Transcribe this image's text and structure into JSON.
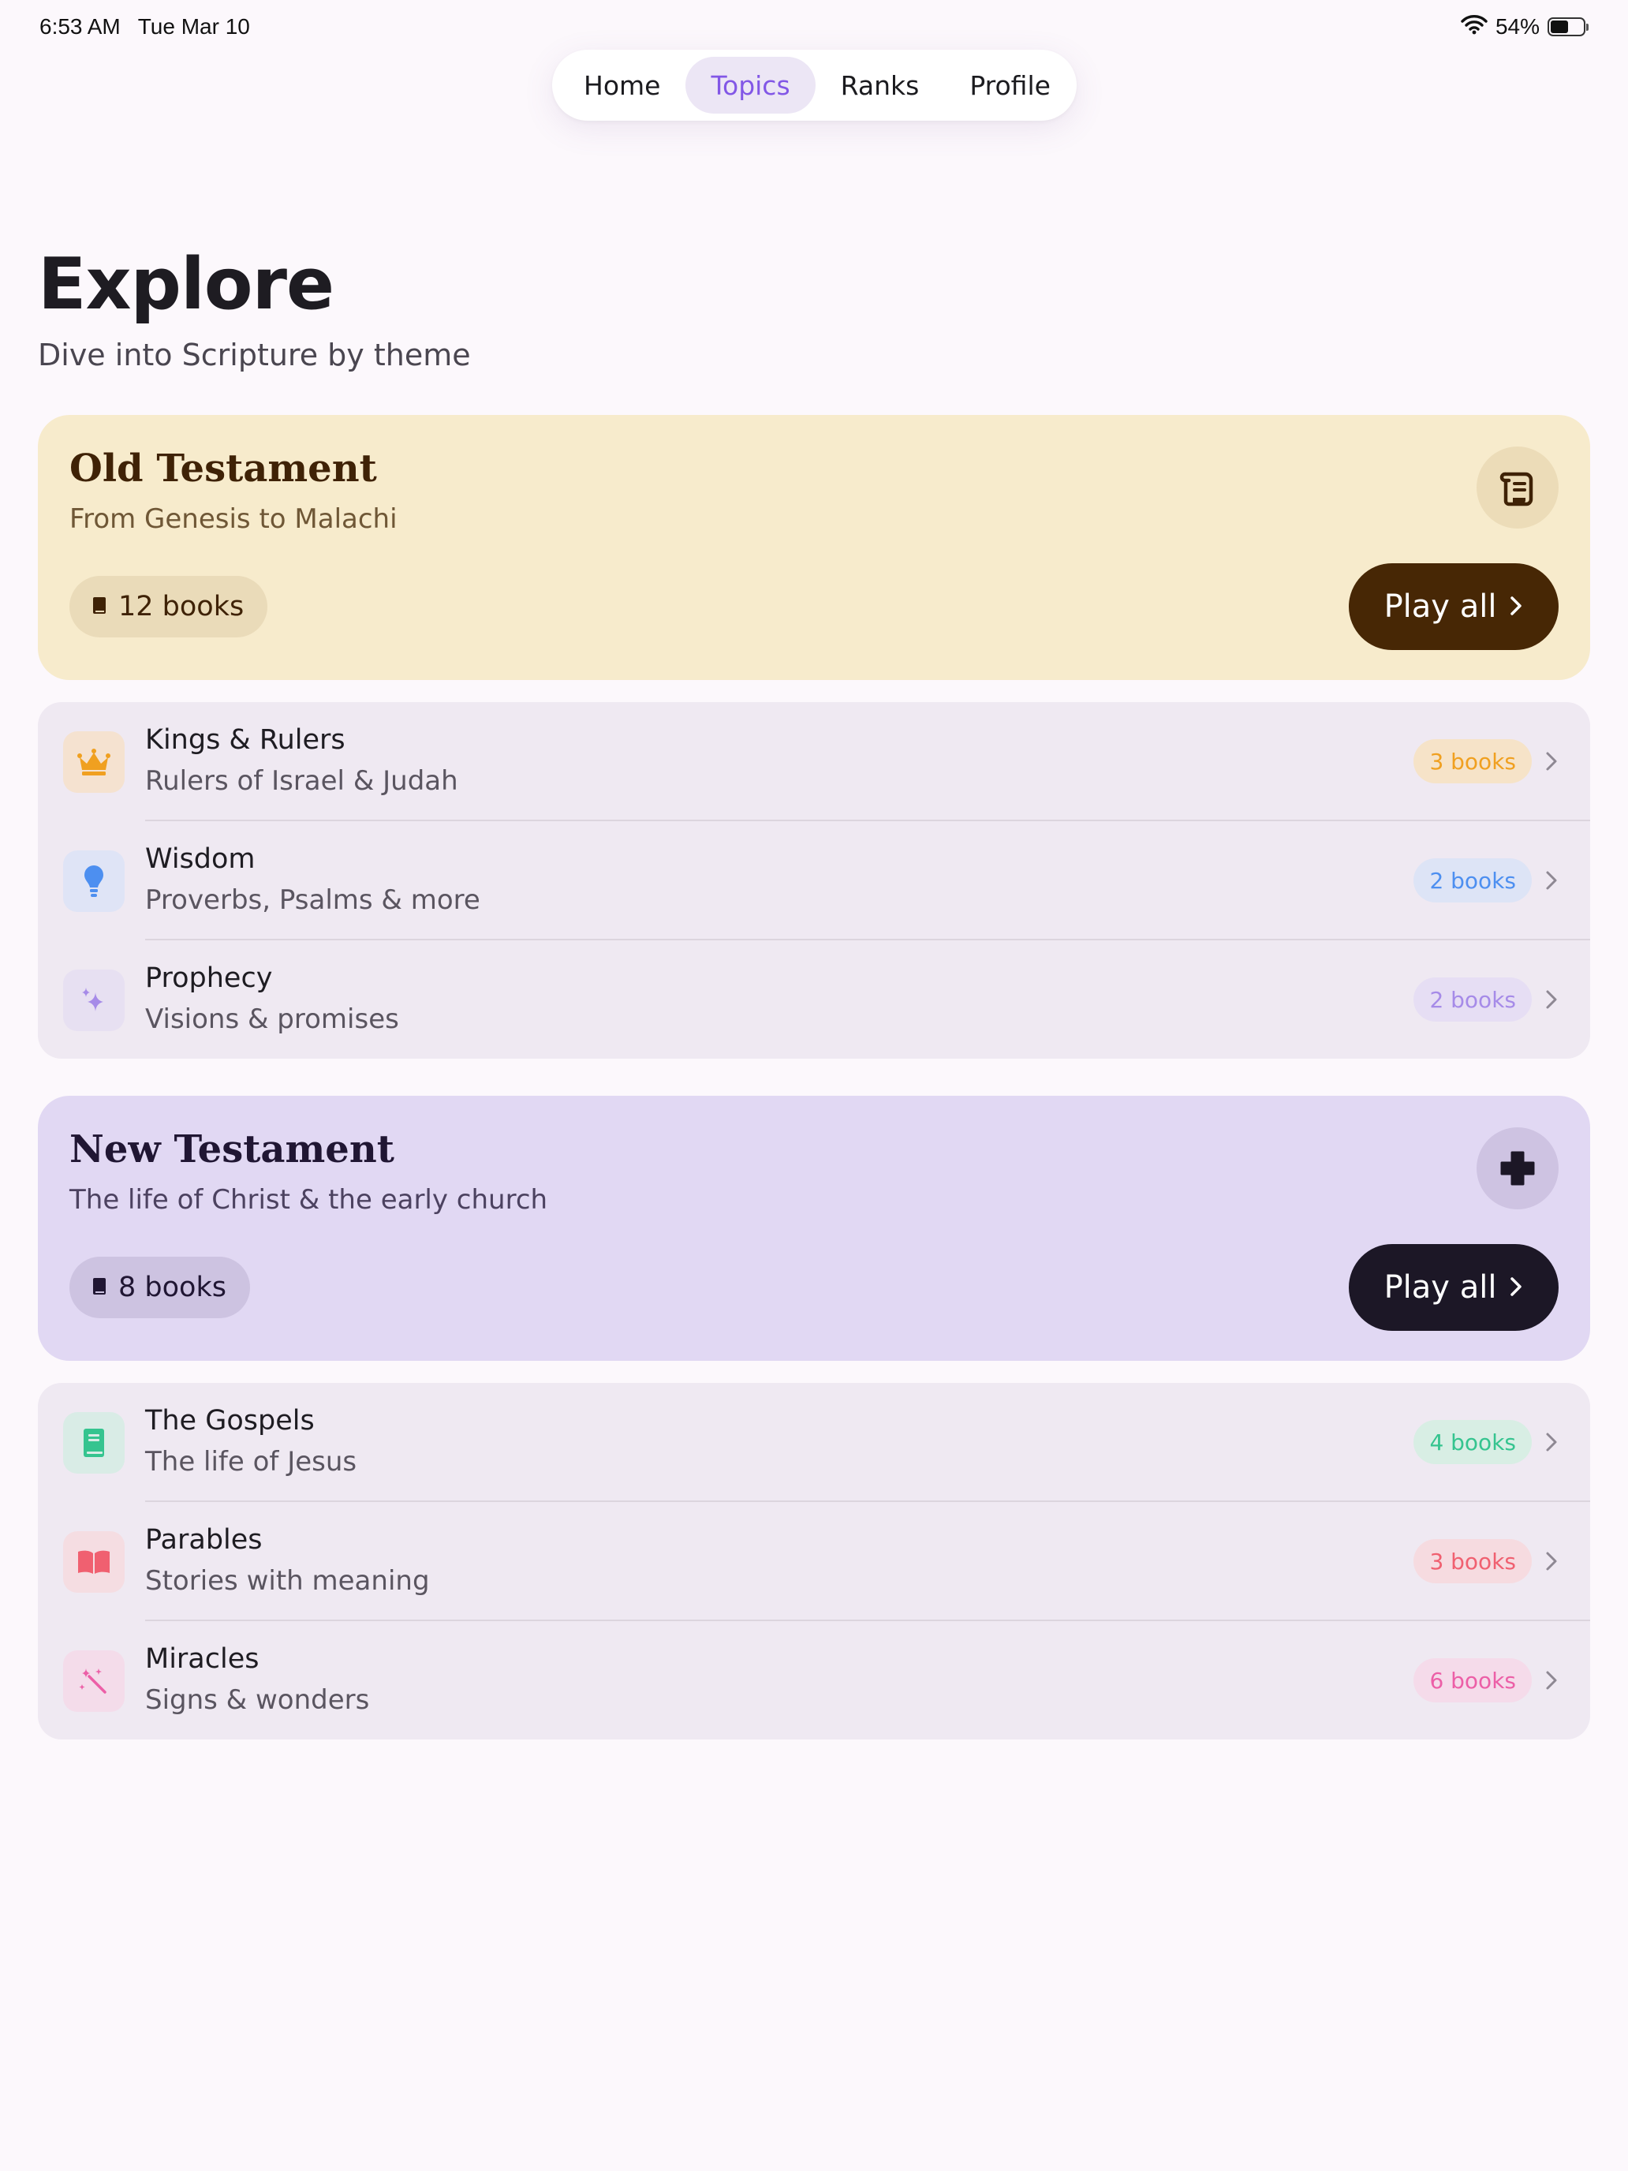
{
  "status_bar": {
    "time": "6:53 AM",
    "date": "Tue Mar 10",
    "battery_percent_label": "54%",
    "battery_level": 0.54,
    "icons": [
      "wifi-icon",
      "battery-icon"
    ]
  },
  "nav": {
    "tabs": [
      {
        "label": "Home",
        "active": false
      },
      {
        "label": "Topics",
        "active": true
      },
      {
        "label": "Ranks",
        "active": false
      },
      {
        "label": "Profile",
        "active": false
      }
    ],
    "active_color": "#8257e6"
  },
  "page": {
    "title": "Explore",
    "subtitle": "Dive into Scripture by theme"
  },
  "sections": [
    {
      "title": "Old Testament",
      "subtitle": "From Genesis to Malachi",
      "icon": "scroll-icon",
      "count_label": "12 books",
      "play_label": "Play all",
      "background": "#f7ebcc",
      "accent": "#472705",
      "topics": [
        {
          "title": "Kings & Rulers",
          "subtitle": "Rulers of Israel & Judah",
          "badge": "3 books",
          "icon": "crown-icon",
          "color": "#f0a020",
          "badge_bg": "#f6e3c8",
          "icon_bg": "#f5e2d0"
        },
        {
          "title": "Wisdom",
          "subtitle": "Proverbs, Psalms & more",
          "badge": "2 books",
          "icon": "lightbulb-icon",
          "color": "#4d8ff0",
          "badge_bg": "#dde4f6",
          "icon_bg": "#dfe4f6"
        },
        {
          "title": "Prophecy",
          "subtitle": "Visions & promises",
          "badge": "2 books",
          "icon": "sparkles-icon",
          "color": "#a68be8",
          "badge_bg": "#e6def4",
          "icon_bg": "#e7e0f2"
        }
      ]
    },
    {
      "title": "New Testament",
      "subtitle": "The life of Christ & the early church",
      "icon": "cross-icon",
      "count_label": "8 books",
      "play_label": "Play all",
      "background": "#e1d8f3",
      "accent": "#1c1726",
      "topics": [
        {
          "title": "The Gospels",
          "subtitle": "The life of Jesus",
          "badge": "4 books",
          "icon": "book-icon",
          "color": "#35c48f",
          "badge_bg": "#d8eee4",
          "icon_bg": "#d9ece6"
        },
        {
          "title": "Parables",
          "subtitle": "Stories with meaning",
          "badge": "3 books",
          "icon": "open-book-icon",
          "color": "#f06070",
          "badge_bg": "#f6dbe0",
          "icon_bg": "#f5dde2"
        },
        {
          "title": "Miracles",
          "subtitle": "Signs & wonders",
          "badge": "6 books",
          "icon": "magic-wand-icon",
          "color": "#ec5fa7",
          "badge_bg": "#f5dbea",
          "icon_bg": "#f4dcea"
        }
      ]
    }
  ]
}
